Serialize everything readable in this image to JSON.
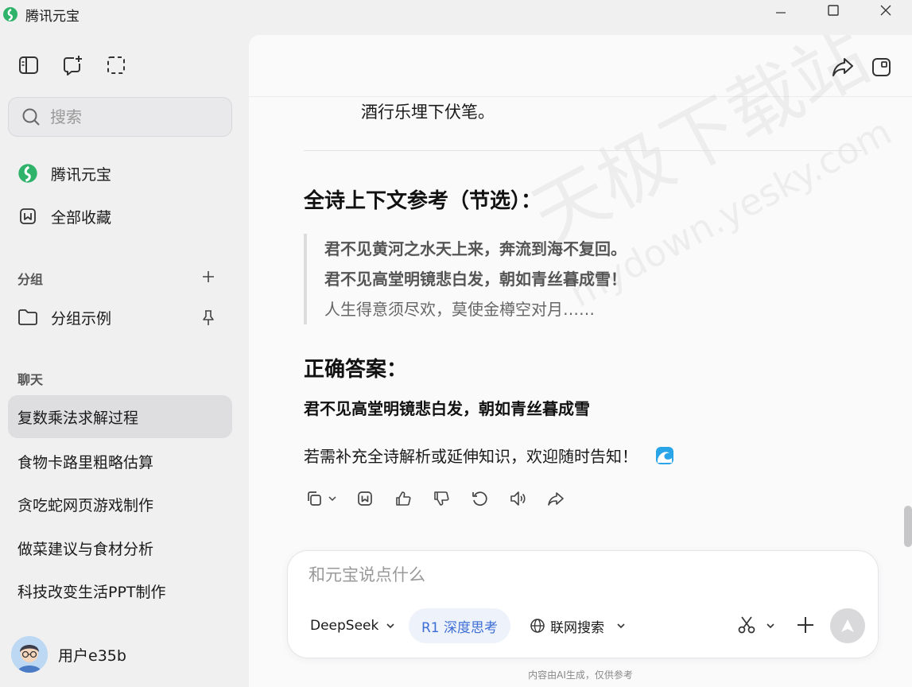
{
  "window": {
    "title": "腾讯元宝"
  },
  "sidebar": {
    "search_placeholder": "搜索",
    "nav": [
      {
        "label": "腾讯元宝",
        "icon": "yuanbao-logo-icon"
      },
      {
        "label": "全部收藏",
        "icon": "bookmark-icon"
      }
    ],
    "groups_label": "分组",
    "groups": [
      {
        "label": "分组示例",
        "icon": "folder-icon"
      }
    ],
    "chats_label": "聊天",
    "chats": [
      {
        "label": "复数乘法求解过程",
        "active": true
      },
      {
        "label": "食物卡路里粗略估算",
        "active": false
      },
      {
        "label": "贪吃蛇网页游戏制作",
        "active": false
      },
      {
        "label": "做菜建议与食材分析",
        "active": false
      },
      {
        "label": "科技改变生活PPT制作",
        "active": false
      }
    ],
    "user": {
      "name": "用户e35b"
    }
  },
  "conversation": {
    "previous_line": "酒行乐埋下伏笔。",
    "context_heading": "全诗上下文参考（节选）：",
    "quote_lines": [
      {
        "text": "君不见黄河之水天上来，奔流到海不复回。",
        "bold": true
      },
      {
        "text": "君不见高堂明镜悲白发，朝如青丝暮成雪！",
        "bold": true
      },
      {
        "text": "人生得意须尽欢，莫使金樽空对月……",
        "bold": false
      }
    ],
    "answer_heading": "正确答案：",
    "answer_text": "君不见高堂明镜悲白发，朝如青丝暮成雪",
    "closing_text": "若需补充全诗解析或延伸知识，欢迎随时告知！"
  },
  "composer": {
    "placeholder": "和元宝说点什么",
    "model_label": "DeepSeek",
    "deep_think_label": "R1 深度思考",
    "web_search_label": "联网搜索"
  },
  "footer": {
    "disclaimer": "内容由AI生成，仅供参考"
  },
  "watermark": {
    "text": "天极下载站",
    "url": "mydown.yesky.com"
  },
  "colors": {
    "accent": "#3c6ed6",
    "brand_green": "#2fb36b",
    "sidebar_bg": "#f0f0f1",
    "main_bg": "#fafafb"
  }
}
